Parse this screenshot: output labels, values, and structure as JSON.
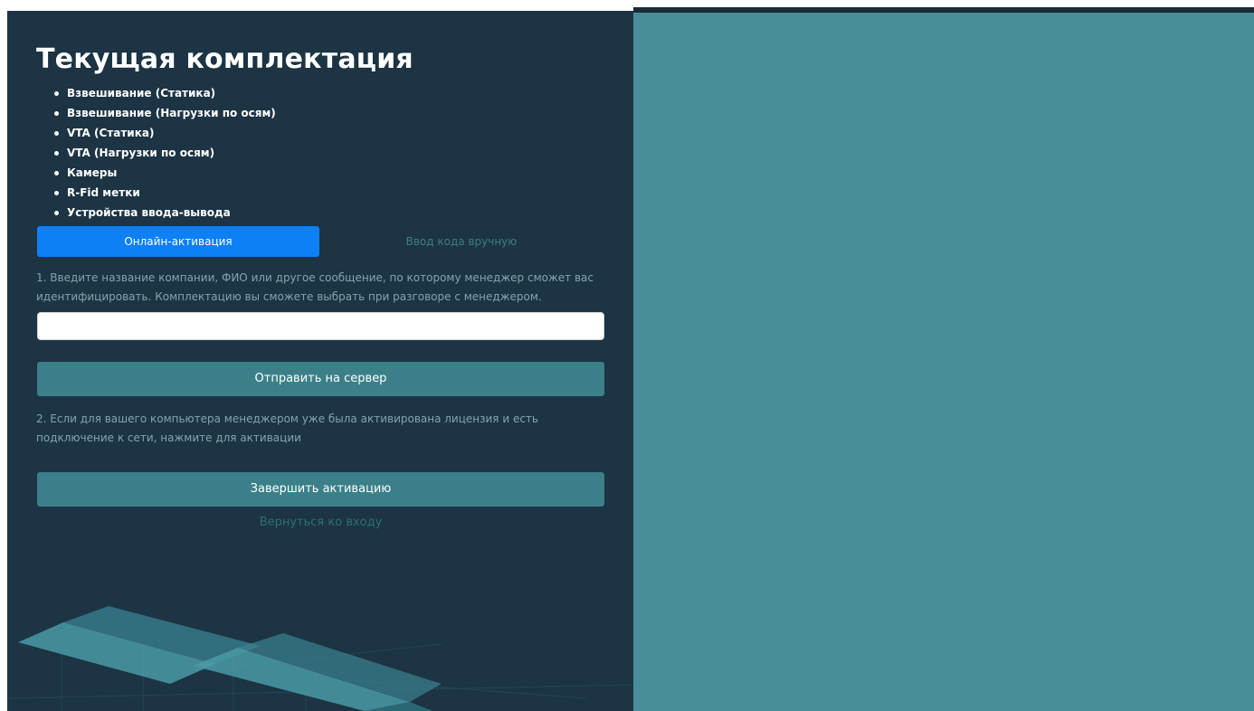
{
  "title": "Текущая комплектация",
  "features": [
    "Взвешивание (Статика)",
    "Взвешивание (Нагрузки по осям)",
    "VTA (Статика)",
    "VTA (Нагрузки по осям)",
    "Камеры",
    "R-Fid метки",
    "Устройства ввода-вывода"
  ],
  "tabs": {
    "online": "Онлайн-активация",
    "manual": "Ввод кода вручную"
  },
  "step1": {
    "text": "1. Введите название компании, ФИО или другое сообщение, по которому менеджер сможет вас идентифицировать. Комплектацию вы сможете выбрать при разговоре с менеджером.",
    "input_value": "",
    "send_label": "Отправить на сервер"
  },
  "step2": {
    "text": "2. Если для вашего компьютера менеджером уже была активирована лицензия и есть подключение к сети, нажмите для активации",
    "finish_label": "Завершить активацию"
  },
  "back_label": "Вернуться ко входу",
  "colors": {
    "panel_bg": "#1c3443",
    "side_bg": "#478e98",
    "accent_blue": "#0d80f6",
    "button_teal": "#3b8088"
  }
}
